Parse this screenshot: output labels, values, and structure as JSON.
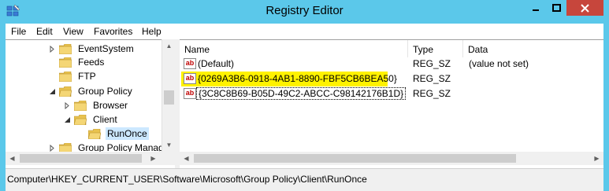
{
  "window": {
    "title": "Registry Editor",
    "colors": {
      "frame": "#5bc8ea",
      "close": "#c7463c",
      "highlight": "#fff200",
      "selection": "#cce8ff"
    }
  },
  "menu": [
    "File",
    "Edit",
    "View",
    "Favorites",
    "Help"
  ],
  "tree": {
    "items": [
      {
        "label": "EventSystem",
        "expander": "collapsed",
        "selected": false
      },
      {
        "label": "Feeds",
        "expander": "none",
        "selected": false
      },
      {
        "label": "FTP",
        "expander": "none",
        "selected": false
      },
      {
        "label": "Group Policy",
        "expander": "expanded",
        "selected": false
      },
      {
        "label": "Browser",
        "expander": "collapsed",
        "selected": false
      },
      {
        "label": "Client",
        "expander": "expanded",
        "selected": false
      },
      {
        "label": "RunOnce",
        "expander": "none",
        "selected": true
      },
      {
        "label": "Group Policy Manag",
        "expander": "collapsed",
        "selected": false
      }
    ]
  },
  "list": {
    "columns": [
      "Name",
      "Type",
      "Data"
    ],
    "rows": [
      {
        "icon": "string-value-icon",
        "icon_text": "ab",
        "name": "(Default)",
        "type": "REG_SZ",
        "data": "(value not set)",
        "highlighted": false
      },
      {
        "icon": "string-value-icon",
        "icon_text": "ab",
        "name": "{0269A3B6-0918-4AB1-8890-FBF5CB6BEA50}",
        "type": "REG_SZ",
        "data": "",
        "highlighted": true
      },
      {
        "icon": "string-value-icon",
        "icon_text": "ab",
        "name": "{3C8C8B69-B05D-49C2-ABCC-C98142176B1D}",
        "type": "REG_SZ",
        "data": "",
        "highlighted": false
      }
    ]
  },
  "status": {
    "path": "Computer\\HKEY_CURRENT_USER\\Software\\Microsoft\\Group Policy\\Client\\RunOnce"
  }
}
